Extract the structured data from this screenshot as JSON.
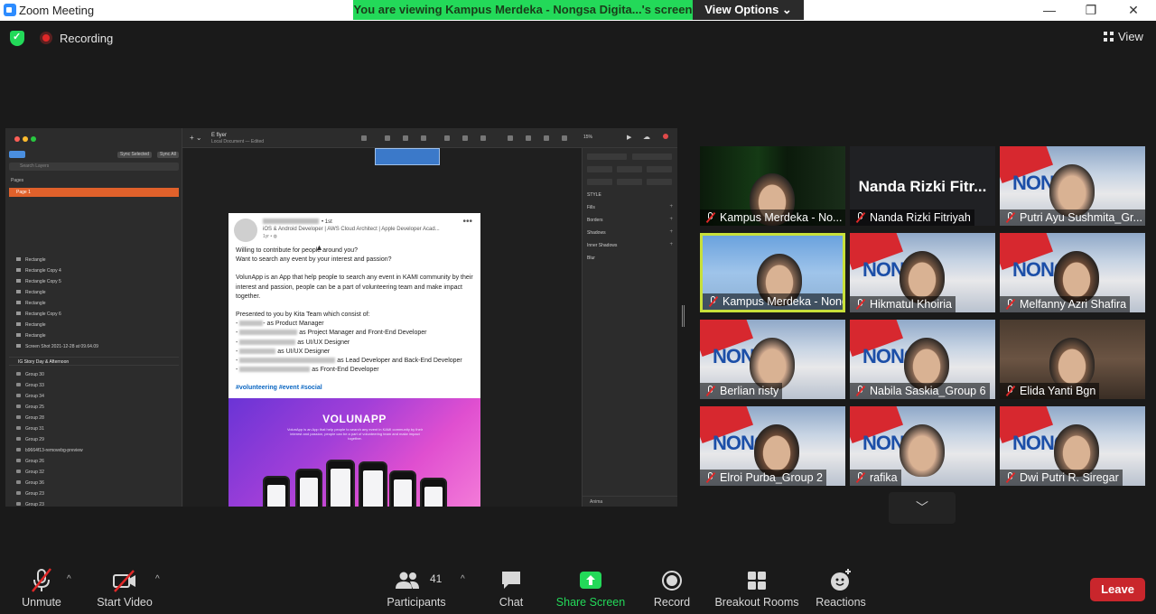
{
  "window": {
    "title": "Zoom Meeting",
    "minimize": "—",
    "restore": "❐",
    "close": "✕"
  },
  "share_banner": "You are viewing Kampus Merdeka - Nongsa Digita...'s screen",
  "view_options": "View Options ⌄",
  "status": {
    "recording": "Recording",
    "view": "View"
  },
  "shared_screen": {
    "doc_title": "E flyer",
    "doc_subtitle": "Local Document — Edited",
    "zoom": "15%",
    "search_placeholder": "Search Layers",
    "sync_selected": "Sync Selected",
    "sync_all": "Sync All",
    "pages_label": "Pages",
    "page1": "Page 1",
    "layers": [
      "Rectangle",
      "Rectangle Copy 4",
      "Rectangle Copy 5",
      "Rectangle",
      "Rectangle",
      "Rectangle Copy 6",
      "Rectangle",
      "Rectangle",
      "Screen Shot 2021-12-28 at 09.64.09"
    ],
    "artboard": "IG Story Day & Afternoon",
    "groups": [
      "Group 30",
      "Group 33",
      "Group 34",
      "Group 25",
      "Group 28",
      "Group 31",
      "Group 29",
      "b9664f13-removebg-preview",
      "Group 26",
      "Group 32",
      "Group 36",
      "Group 23",
      "Group 23"
    ],
    "inspector": [
      "STYLE",
      "Fills",
      "Borders",
      "Shadows",
      "Inner Shadows",
      "Blur"
    ],
    "bottom_label": "Anima",
    "post": {
      "degree": "• 1st",
      "headline": "iOS & Android Developer | AWS Cloud Architect | Apple Developer Acad...",
      "time": "1yr • ◍",
      "line1": "Willing to contribute for people around you?",
      "line2": "Want to search any event by your interest and passion?",
      "para": "VolunApp is an App that help people to search any event in KAMI community by their interest and passion, people can be a part of volunteering team and make impact together.",
      "presented": "Presented to you by Kita Team which consist of:",
      "roles": [
        "- as Product Manager",
        "as Project Manager and Front-End Developer",
        "as UI/UX Designer",
        "as UI/UX Designer",
        "as Lead Developer and Back-End Developer",
        "as Front-End Developer"
      ],
      "tags": "#volunteering #event #social",
      "banner_title": "VOLUNAPP",
      "banner_sub": "VolunApp is an App that help people to search any event in KAMI community by their interest and passion, people can be a part of volunteering team and make impact together."
    }
  },
  "gallery": [
    {
      "name": "Kampus Merdeka - No...",
      "bg": "matrix",
      "big": ""
    },
    {
      "name": "Nanda Rizki Fitriyah",
      "bg": "dark",
      "big": "Nanda Rizki Fitr..."
    },
    {
      "name": "Putri Ayu Sushmita_Gr...",
      "bg": "nongsa",
      "big": ""
    },
    {
      "name": "Kampus Merdeka - Nong...",
      "bg": "blue",
      "big": ""
    },
    {
      "name": "Hikmatul Khoiria",
      "bg": "nongsa",
      "big": ""
    },
    {
      "name": "Melfanny Azri Shafira",
      "bg": "nongsa",
      "big": ""
    },
    {
      "name": "Berlian risty",
      "bg": "nongsa",
      "big": ""
    },
    {
      "name": "Nabila Saskia_Group 6",
      "bg": "nongsa",
      "big": ""
    },
    {
      "name": "Elida Yanti Bgn",
      "bg": "room",
      "big": ""
    },
    {
      "name": "Elroi Purba_Group 2",
      "bg": "nongsa",
      "big": ""
    },
    {
      "name": "rafika",
      "bg": "nongsa",
      "big": ""
    },
    {
      "name": "Dwi Putri R. Siregar",
      "bg": "nongsa",
      "big": ""
    }
  ],
  "nongsa_sign": "NONGSA",
  "toolbar": {
    "unmute": "Unmute",
    "start_video": "Start Video",
    "participants": "Participants",
    "participants_count": "41",
    "chat": "Chat",
    "share_screen": "Share Screen",
    "record": "Record",
    "breakout": "Breakout Rooms",
    "reactions": "Reactions",
    "leave": "Leave"
  },
  "colors": {
    "share_green": "#23d959",
    "leave_red": "#c9262c",
    "active_speaker": "#c8e03a"
  }
}
